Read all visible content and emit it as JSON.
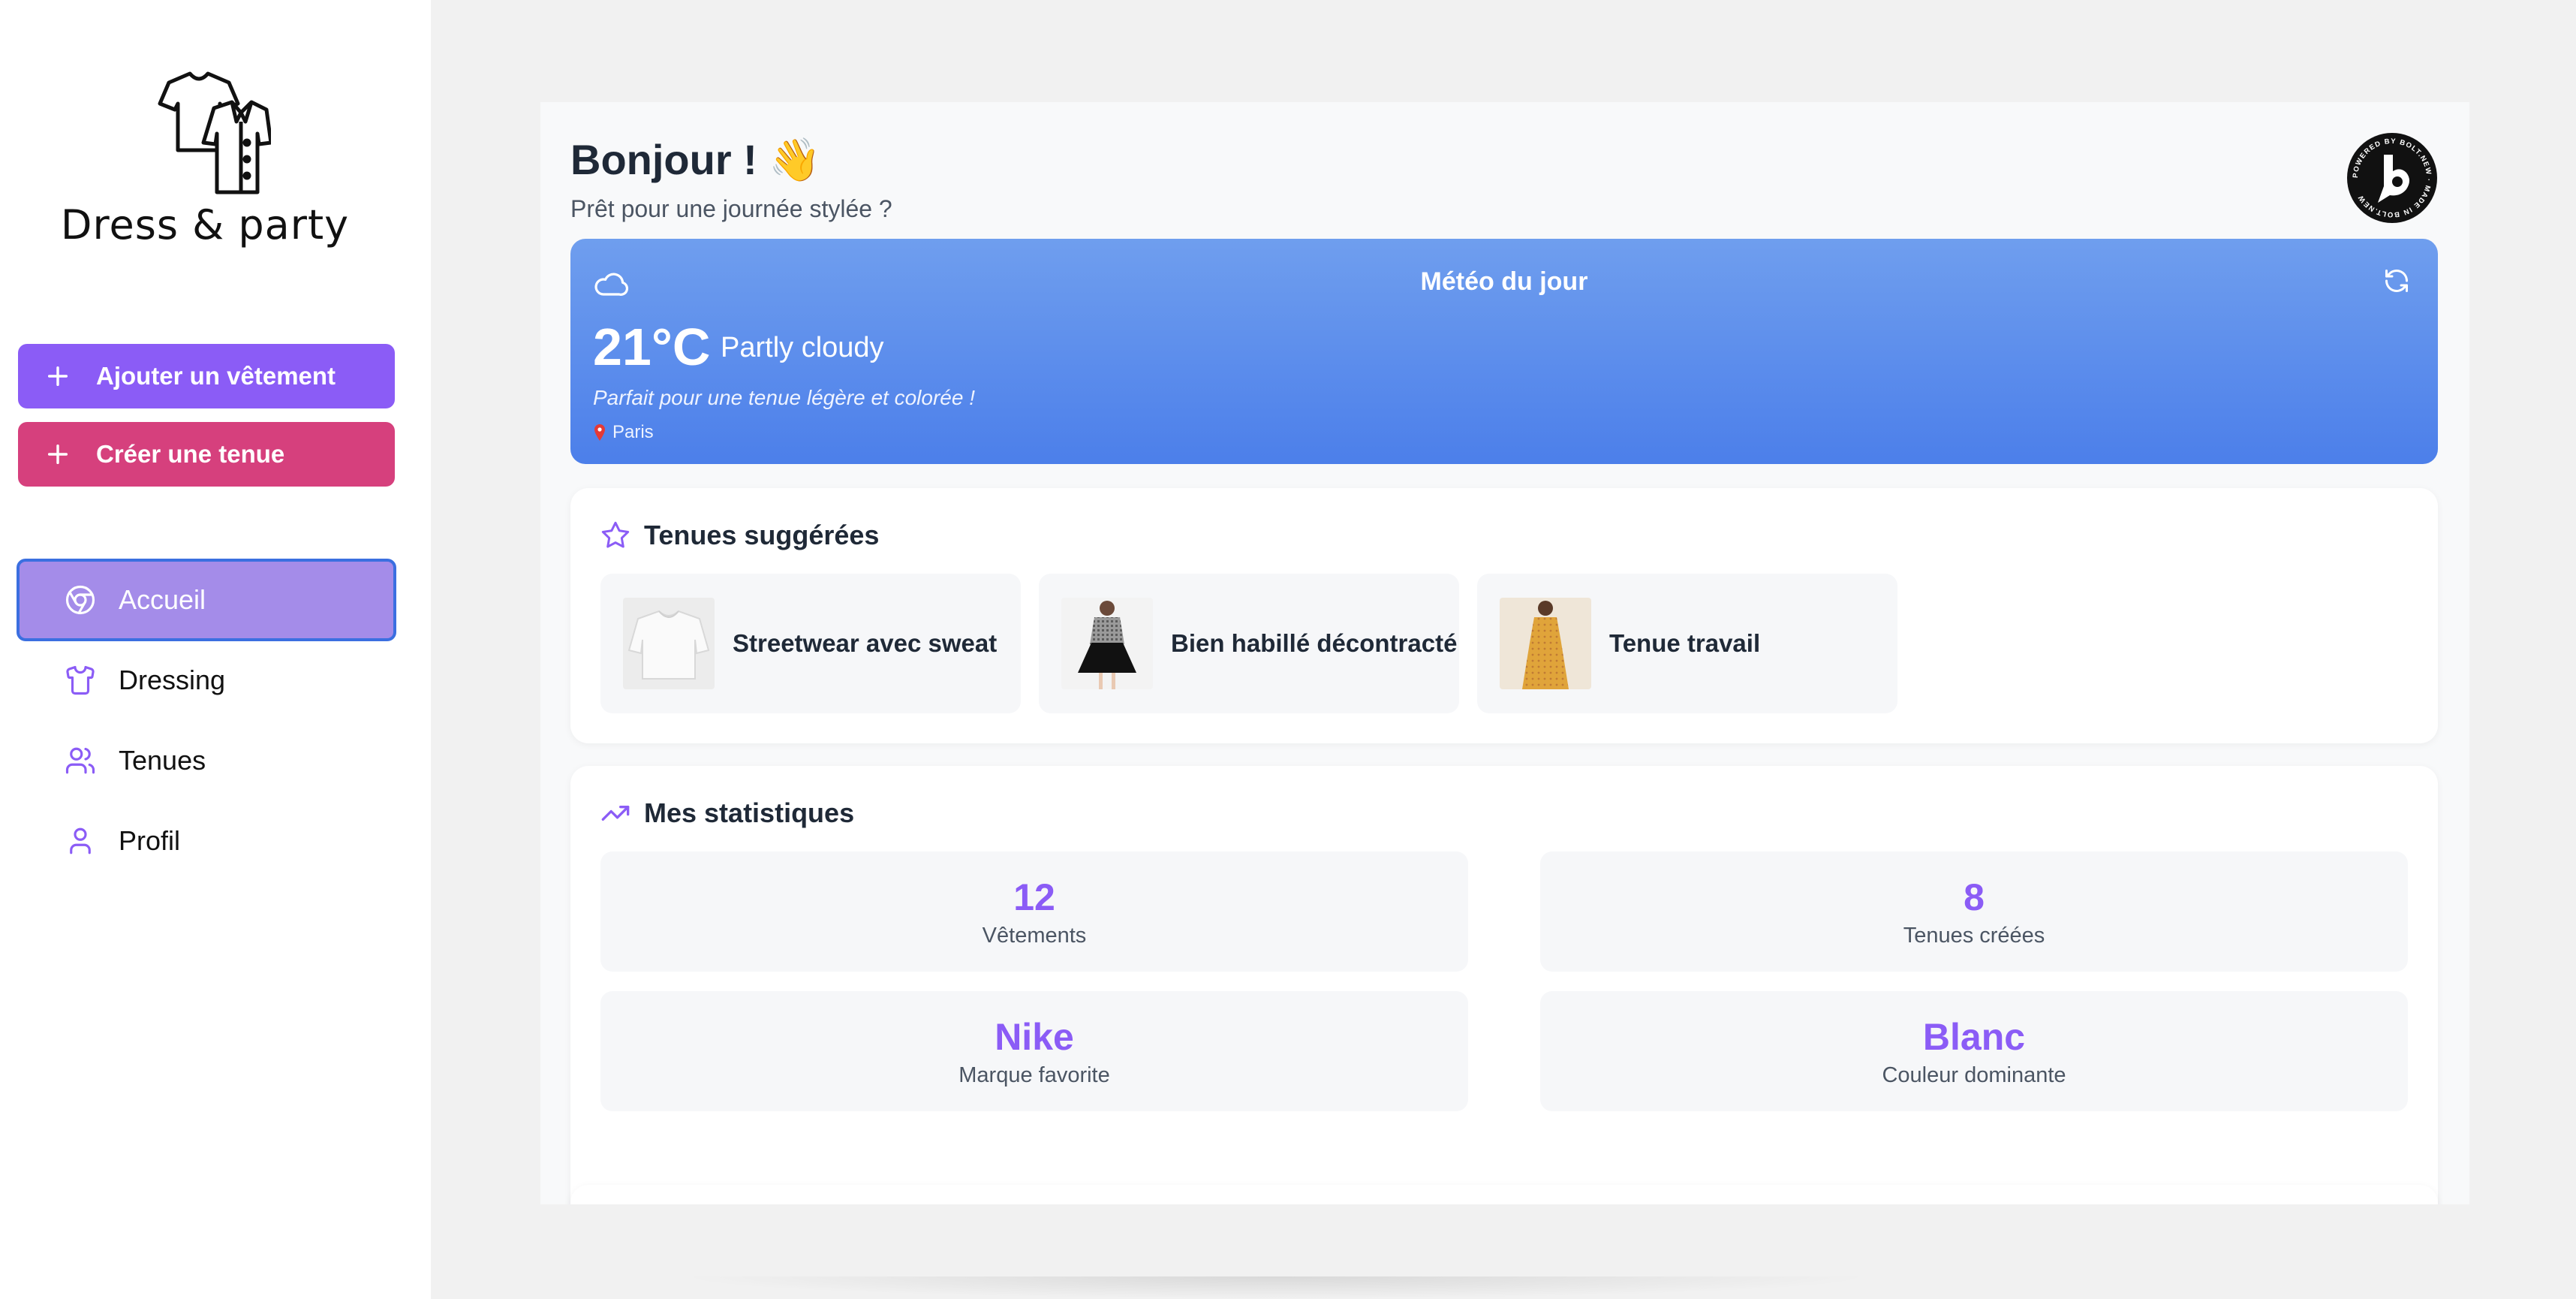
{
  "app": {
    "name": "Dress & party"
  },
  "sidebar": {
    "actions": [
      {
        "label": "Ajouter un vêtement",
        "icon": "plus-icon",
        "color": "#8b5cf6"
      },
      {
        "label": "Créer une tenue",
        "icon": "plus-icon",
        "color": "#d6407d"
      }
    ],
    "nav": [
      {
        "label": "Accueil",
        "icon": "chrome-icon",
        "active": true
      },
      {
        "label": "Dressing",
        "icon": "shirt-icon",
        "active": false
      },
      {
        "label": "Tenues",
        "icon": "users-icon",
        "active": false
      },
      {
        "label": "Profil",
        "icon": "user-icon",
        "active": false
      }
    ]
  },
  "header": {
    "greeting": "Bonjour ! 👋",
    "subtitle": "Prêt pour une journée stylée ?",
    "badge": "POWERED BY BOLT.NEW · MADE IN BOLT.NEW"
  },
  "weather": {
    "title": "Météo du jour",
    "temperature": "21°C",
    "condition": "Partly cloudy",
    "tip": "Parfait pour une tenue légère et colorée !",
    "location": "Paris",
    "icon": "cloud-icon",
    "refresh_icon": "refresh-icon"
  },
  "suggestions": {
    "title": "Tenues suggérées",
    "icon": "star-icon",
    "items": [
      {
        "name": "Streetwear avec sweat"
      },
      {
        "name": "Bien habillé décontracté"
      },
      {
        "name": "Tenue travail"
      }
    ]
  },
  "stats": {
    "title": "Mes statistiques",
    "icon": "trending-up-icon",
    "items": [
      {
        "value": "12",
        "label": "Vêtements"
      },
      {
        "value": "8",
        "label": "Tenues créées"
      },
      {
        "value": "Nike",
        "label": "Marque favorite"
      },
      {
        "value": "Blanc",
        "label": "Couleur dominante"
      }
    ]
  },
  "colors": {
    "accent": "#8b5cf6",
    "pink": "#d6407d",
    "active_nav": "#a48ce9",
    "weather_gradient": [
      "#6f9eee",
      "#4c7fea"
    ]
  }
}
